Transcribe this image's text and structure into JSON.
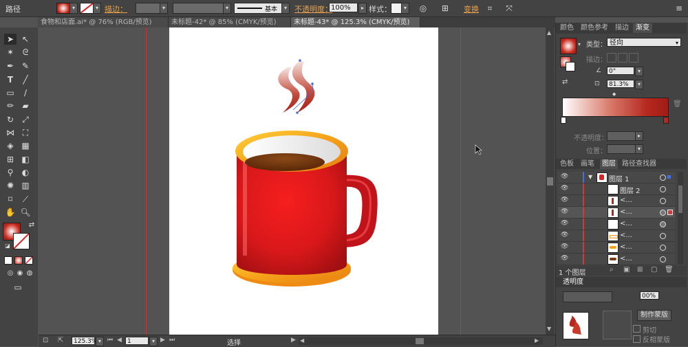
{
  "control_bar": {
    "path_label": "路径",
    "stroke_label": "描边：",
    "brush_label": "基本",
    "opacity_label": "不透明度：",
    "opacity_value": "100%",
    "style_label": "样式：",
    "transform_label": "变换"
  },
  "doc_tabs": [
    {
      "label": "食物和店面.ai* @ 76% (RGB/预览)"
    },
    {
      "label": "未标题-42* @ 85% (CMYK/预览)"
    },
    {
      "label": "未标题-43* @ 125.3% (CMYK/预览)"
    }
  ],
  "gradient_panel": {
    "tabs": [
      "颜色",
      "颜色参考",
      "描边",
      "渐变"
    ],
    "type_label": "类型：",
    "type_value": "径向",
    "stroke_label": "描边：",
    "angle_value": "0°",
    "aspect_value": "81.3%",
    "opacity_label": "不透明度：",
    "position_label": "位置："
  },
  "layers_panel": {
    "tabs": [
      "色板",
      "画笔",
      "图层",
      "路径查找器"
    ],
    "layer_name": "图层 1",
    "sublayer_name": "图层 2",
    "item_label": "<...",
    "footer": "1 个图层"
  },
  "transparency_panel": {
    "title": "透明度",
    "opacity_value": "00%",
    "make_mask": "制作蒙版",
    "invert_mask": "反相蒙版",
    "clip_label": "剪切"
  },
  "status_bar": {
    "zoom": "125.3%",
    "page": "1",
    "tool": "选择"
  },
  "colors": {
    "mug_red": "#e31b1b",
    "rim_orange": "#f6a21a",
    "coffee_brown": "#7a3b10",
    "steam_red": "#b5281f"
  }
}
